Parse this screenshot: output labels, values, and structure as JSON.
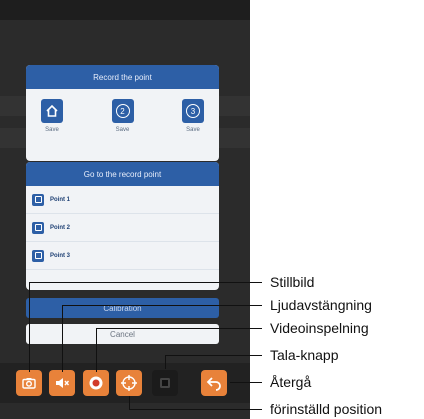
{
  "dialog": {
    "record_header": "Record the point",
    "slots": [
      {
        "icon": "home-icon",
        "label": "Save"
      },
      {
        "icon": "point-2-icon",
        "number": "2",
        "label": "Save"
      },
      {
        "icon": "point-3-icon",
        "number": "3",
        "label": "Save"
      }
    ],
    "goto_header": "Go to the record point",
    "goto_items": [
      {
        "icon": "point-icon",
        "label": "Point 1"
      },
      {
        "icon": "point-icon",
        "label": "Point 2"
      },
      {
        "icon": "point-icon",
        "label": "Point 3"
      }
    ],
    "calibration_label": "Calibration",
    "cancel_label": "Cancel"
  },
  "toolbar": {
    "buttons": [
      {
        "name": "snapshot",
        "icon": "camera-icon"
      },
      {
        "name": "mute",
        "icon": "speaker-mute-icon"
      },
      {
        "name": "record",
        "icon": "record-icon"
      },
      {
        "name": "preset",
        "icon": "crosshair-icon"
      },
      {
        "name": "talk",
        "icon": "talk-icon"
      },
      {
        "name": "back",
        "icon": "back-arrow-icon"
      }
    ]
  },
  "callouts": {
    "snapshot": "Stillbild",
    "mute": "Ljudavstängning",
    "record": "Videoinspelning",
    "talk": "Tala-knapp",
    "back": "Återgå",
    "preset": "förinställd position"
  },
  "colors": {
    "accent_blue": "#2d5fa6",
    "button_orange": "#e8823a",
    "background_dark": "#2b2b2b"
  }
}
